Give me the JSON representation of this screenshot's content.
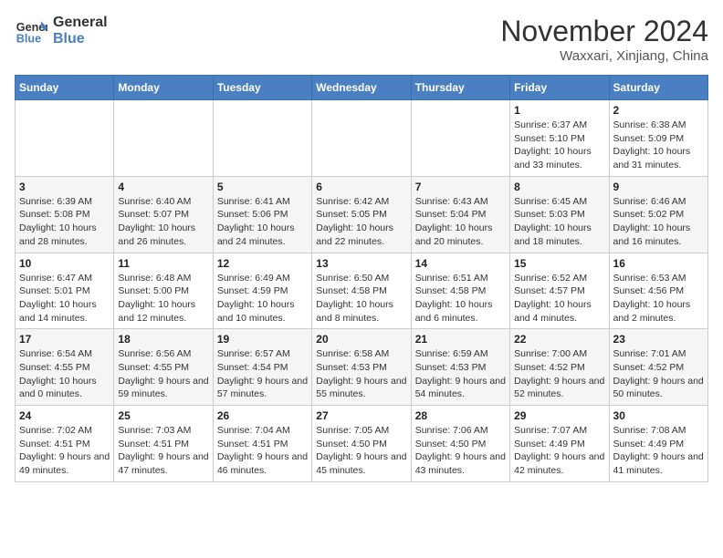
{
  "header": {
    "logo_line1": "General",
    "logo_line2": "Blue",
    "month": "November 2024",
    "location": "Waxxari, Xinjiang, China"
  },
  "weekdays": [
    "Sunday",
    "Monday",
    "Tuesday",
    "Wednesday",
    "Thursday",
    "Friday",
    "Saturday"
  ],
  "weeks": [
    [
      {
        "day": "",
        "info": ""
      },
      {
        "day": "",
        "info": ""
      },
      {
        "day": "",
        "info": ""
      },
      {
        "day": "",
        "info": ""
      },
      {
        "day": "",
        "info": ""
      },
      {
        "day": "1",
        "info": "Sunrise: 6:37 AM\nSunset: 5:10 PM\nDaylight: 10 hours and 33 minutes."
      },
      {
        "day": "2",
        "info": "Sunrise: 6:38 AM\nSunset: 5:09 PM\nDaylight: 10 hours and 31 minutes."
      }
    ],
    [
      {
        "day": "3",
        "info": "Sunrise: 6:39 AM\nSunset: 5:08 PM\nDaylight: 10 hours and 28 minutes."
      },
      {
        "day": "4",
        "info": "Sunrise: 6:40 AM\nSunset: 5:07 PM\nDaylight: 10 hours and 26 minutes."
      },
      {
        "day": "5",
        "info": "Sunrise: 6:41 AM\nSunset: 5:06 PM\nDaylight: 10 hours and 24 minutes."
      },
      {
        "day": "6",
        "info": "Sunrise: 6:42 AM\nSunset: 5:05 PM\nDaylight: 10 hours and 22 minutes."
      },
      {
        "day": "7",
        "info": "Sunrise: 6:43 AM\nSunset: 5:04 PM\nDaylight: 10 hours and 20 minutes."
      },
      {
        "day": "8",
        "info": "Sunrise: 6:45 AM\nSunset: 5:03 PM\nDaylight: 10 hours and 18 minutes."
      },
      {
        "day": "9",
        "info": "Sunrise: 6:46 AM\nSunset: 5:02 PM\nDaylight: 10 hours and 16 minutes."
      }
    ],
    [
      {
        "day": "10",
        "info": "Sunrise: 6:47 AM\nSunset: 5:01 PM\nDaylight: 10 hours and 14 minutes."
      },
      {
        "day": "11",
        "info": "Sunrise: 6:48 AM\nSunset: 5:00 PM\nDaylight: 10 hours and 12 minutes."
      },
      {
        "day": "12",
        "info": "Sunrise: 6:49 AM\nSunset: 4:59 PM\nDaylight: 10 hours and 10 minutes."
      },
      {
        "day": "13",
        "info": "Sunrise: 6:50 AM\nSunset: 4:58 PM\nDaylight: 10 hours and 8 minutes."
      },
      {
        "day": "14",
        "info": "Sunrise: 6:51 AM\nSunset: 4:58 PM\nDaylight: 10 hours and 6 minutes."
      },
      {
        "day": "15",
        "info": "Sunrise: 6:52 AM\nSunset: 4:57 PM\nDaylight: 10 hours and 4 minutes."
      },
      {
        "day": "16",
        "info": "Sunrise: 6:53 AM\nSunset: 4:56 PM\nDaylight: 10 hours and 2 minutes."
      }
    ],
    [
      {
        "day": "17",
        "info": "Sunrise: 6:54 AM\nSunset: 4:55 PM\nDaylight: 10 hours and 0 minutes."
      },
      {
        "day": "18",
        "info": "Sunrise: 6:56 AM\nSunset: 4:55 PM\nDaylight: 9 hours and 59 minutes."
      },
      {
        "day": "19",
        "info": "Sunrise: 6:57 AM\nSunset: 4:54 PM\nDaylight: 9 hours and 57 minutes."
      },
      {
        "day": "20",
        "info": "Sunrise: 6:58 AM\nSunset: 4:53 PM\nDaylight: 9 hours and 55 minutes."
      },
      {
        "day": "21",
        "info": "Sunrise: 6:59 AM\nSunset: 4:53 PM\nDaylight: 9 hours and 54 minutes."
      },
      {
        "day": "22",
        "info": "Sunrise: 7:00 AM\nSunset: 4:52 PM\nDaylight: 9 hours and 52 minutes."
      },
      {
        "day": "23",
        "info": "Sunrise: 7:01 AM\nSunset: 4:52 PM\nDaylight: 9 hours and 50 minutes."
      }
    ],
    [
      {
        "day": "24",
        "info": "Sunrise: 7:02 AM\nSunset: 4:51 PM\nDaylight: 9 hours and 49 minutes."
      },
      {
        "day": "25",
        "info": "Sunrise: 7:03 AM\nSunset: 4:51 PM\nDaylight: 9 hours and 47 minutes."
      },
      {
        "day": "26",
        "info": "Sunrise: 7:04 AM\nSunset: 4:51 PM\nDaylight: 9 hours and 46 minutes."
      },
      {
        "day": "27",
        "info": "Sunrise: 7:05 AM\nSunset: 4:50 PM\nDaylight: 9 hours and 45 minutes."
      },
      {
        "day": "28",
        "info": "Sunrise: 7:06 AM\nSunset: 4:50 PM\nDaylight: 9 hours and 43 minutes."
      },
      {
        "day": "29",
        "info": "Sunrise: 7:07 AM\nSunset: 4:49 PM\nDaylight: 9 hours and 42 minutes."
      },
      {
        "day": "30",
        "info": "Sunrise: 7:08 AM\nSunset: 4:49 PM\nDaylight: 9 hours and 41 minutes."
      }
    ]
  ]
}
